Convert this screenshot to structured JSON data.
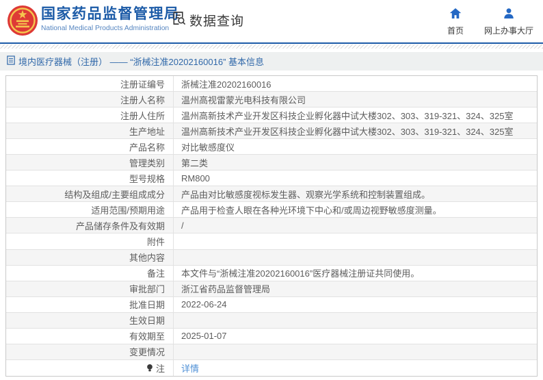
{
  "header": {
    "agency_title": "国家药品监督管理局",
    "agency_subtitle": "National Medical Products Administration",
    "section_title": "数据查询",
    "nav_items": [
      {
        "label": "首页",
        "icon": "home-icon"
      },
      {
        "label": "网上办事大厅",
        "icon": "person-icon"
      }
    ]
  },
  "breadcrumb": {
    "text": "境内医疗器械（注册） —— “浙械注准20202160016” 基本信息"
  },
  "table": {
    "rows": [
      {
        "label": "注册证编号",
        "value": "浙械注准20202160016"
      },
      {
        "label": "注册人名称",
        "value": "温州高视雷蒙光电科技有限公司"
      },
      {
        "label": "注册人住所",
        "value": "温州高新技术产业开发区科技企业孵化器中试大楼302、303、319-321、324、325室"
      },
      {
        "label": "生产地址",
        "value": "温州高新技术产业开发区科技企业孵化器中试大楼302、303、319-321、324、325室"
      },
      {
        "label": "产品名称",
        "value": "对比敏感度仪"
      },
      {
        "label": "管理类别",
        "value": "第二类"
      },
      {
        "label": "型号规格",
        "value": "RM800"
      },
      {
        "label": "结构及组成/主要组成成分",
        "value": "产品由对比敏感度视标发生器、观察光学系统和控制装置组成。"
      },
      {
        "label": "适用范围/预期用途",
        "value": "产品用于检查人眼在各种光环境下中心和/或周边视野敏感度测量。"
      },
      {
        "label": "产品储存条件及有效期",
        "value": "/"
      },
      {
        "label": "附件",
        "value": ""
      },
      {
        "label": "其他内容",
        "value": ""
      },
      {
        "label": "备注",
        "value": "本文件与“浙械注准20202160016”医疗器械注册证共同使用。"
      },
      {
        "label": "审批部门",
        "value": "浙江省药品监督管理局"
      },
      {
        "label": "批准日期",
        "value": "2022-06-24"
      },
      {
        "label": "生效日期",
        "value": ""
      },
      {
        "label": "有效期至",
        "value": "2025-01-07"
      },
      {
        "label": "变更情况",
        "value": ""
      },
      {
        "label": "注",
        "value": "详情",
        "value_is_link": true,
        "label_icon": "lightbulb-icon"
      }
    ]
  },
  "colors": {
    "brand_blue": "#1c5ba7",
    "icon_blue": "#2468c4",
    "link_blue": "#4e8fd6",
    "breadcrumb_text": "#3068a9",
    "row_alt_bg": "#f5f5f5"
  }
}
